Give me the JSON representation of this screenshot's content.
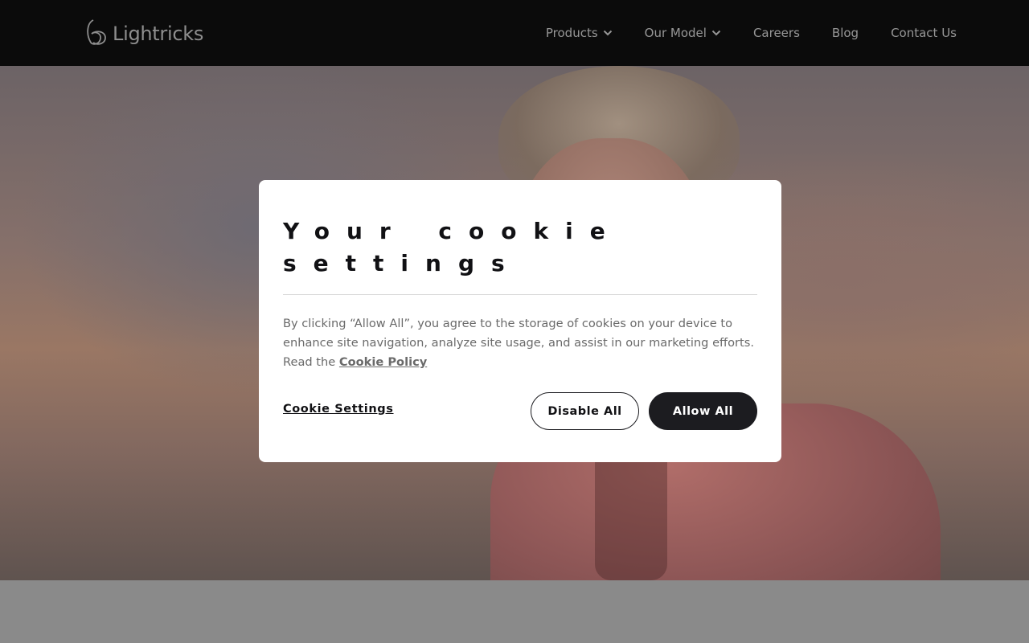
{
  "header": {
    "logo_text": "Lightricks",
    "nav": [
      {
        "label": "Products",
        "has_dropdown": true
      },
      {
        "label": "Our Model",
        "has_dropdown": true
      },
      {
        "label": "Careers",
        "has_dropdown": false
      },
      {
        "label": "Blog",
        "has_dropdown": false
      },
      {
        "label": "Contact Us",
        "has_dropdown": false
      }
    ]
  },
  "cookie_modal": {
    "title_line1": "Your cookie",
    "title_line2": "settings",
    "body_text": "By clicking “Allow All”, you agree to the storage of cookies on your device to enhance site navigation, analyze site usage, and assist in our marketing efforts. Read the ",
    "policy_link": "Cookie Policy",
    "settings_link": "Cookie Settings",
    "disable_all_label": "Disable All",
    "allow_all_label": "Allow All"
  },
  "icons": {
    "logo": "lightricks-logo-icon",
    "dropdown": "chevron-down-icon"
  },
  "colors": {
    "header_bg": "#0b0b0b",
    "nav_text": "#979797",
    "primary_button": "#1c1c20",
    "modal_bg": "#ffffff"
  }
}
